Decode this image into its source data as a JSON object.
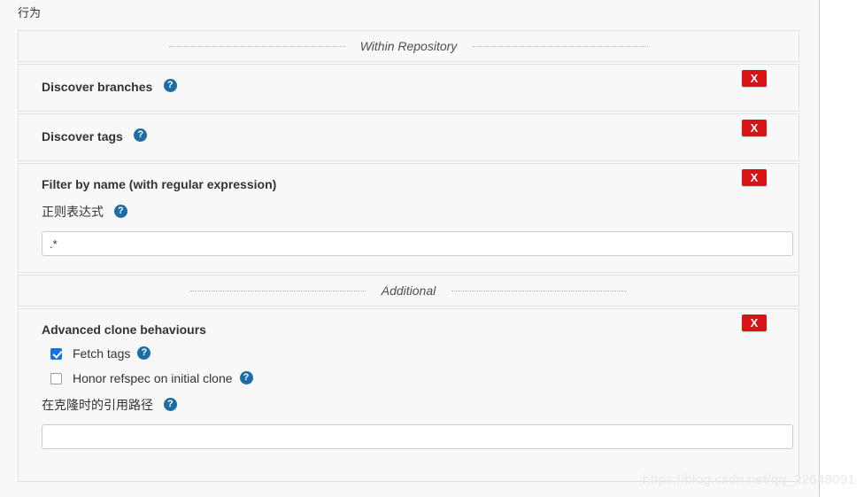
{
  "page": {
    "section_title": "行为",
    "watermark": "https://blog.csdn.net/qq_22648091"
  },
  "separators": {
    "within_repository": "Within Repository",
    "additional": "Additional"
  },
  "help_icon_glyph": "?",
  "delete_button_label": "X",
  "blocks": [
    {
      "id": "discover-branches",
      "title": "Discover branches",
      "help": "?",
      "delete": "X"
    },
    {
      "id": "discover-tags",
      "title": "Discover tags",
      "help": "?",
      "delete": "X"
    },
    {
      "id": "filter-by-name",
      "title": "Filter by name (with regular expression)",
      "field_label": "正则表达式",
      "field_help": "?",
      "field_value": ".*",
      "field_placeholder": "",
      "delete": "X"
    },
    {
      "id": "advanced-clone-behaviours",
      "title": "Advanced clone behaviours",
      "delete": "X",
      "checkboxes": [
        {
          "label": "Fetch tags",
          "checked": true,
          "help": "?"
        },
        {
          "label": "Honor refspec on initial clone",
          "checked": false,
          "help": "?"
        }
      ],
      "ref_field_label": "在克隆时的引用路径",
      "ref_field_help": "?",
      "ref_field_value": "",
      "ref_field_placeholder": ""
    }
  ],
  "colors": {
    "accent_blue": "#1b6ea5",
    "checkbox_blue": "#1673e6",
    "delete_red": "#d81515",
    "panel_bg": "#f8f8f8",
    "border": "#e0e0e0"
  }
}
